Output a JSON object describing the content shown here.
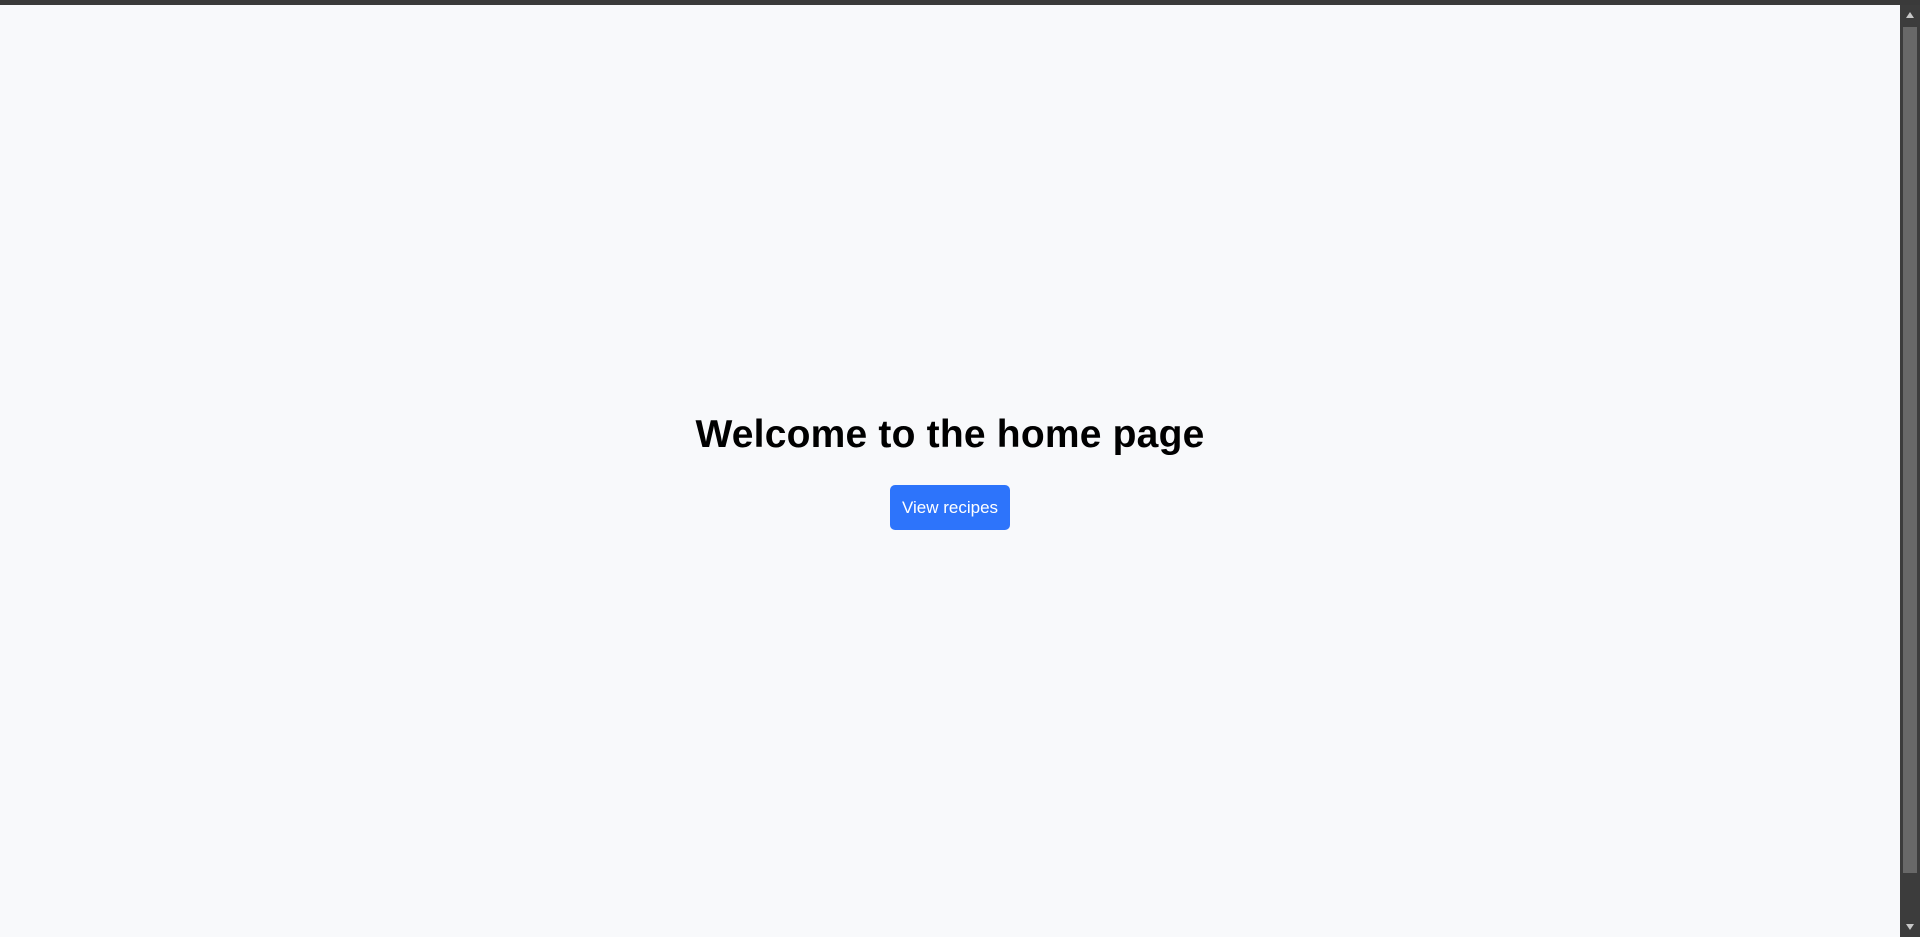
{
  "page": {
    "heading": "Welcome to the home page",
    "primary_button_label": "View recipes"
  },
  "colors": {
    "page_background": "#f8f9fb",
    "heading_text": "#000000",
    "button_background": "#2d74fb",
    "button_text": "#ffffff",
    "scrollbar_track": "#3c3c3c",
    "scrollbar_thumb": "#686868"
  },
  "icons": {
    "scroll_up": "triangle-up-icon",
    "scroll_down": "triangle-down-icon"
  }
}
